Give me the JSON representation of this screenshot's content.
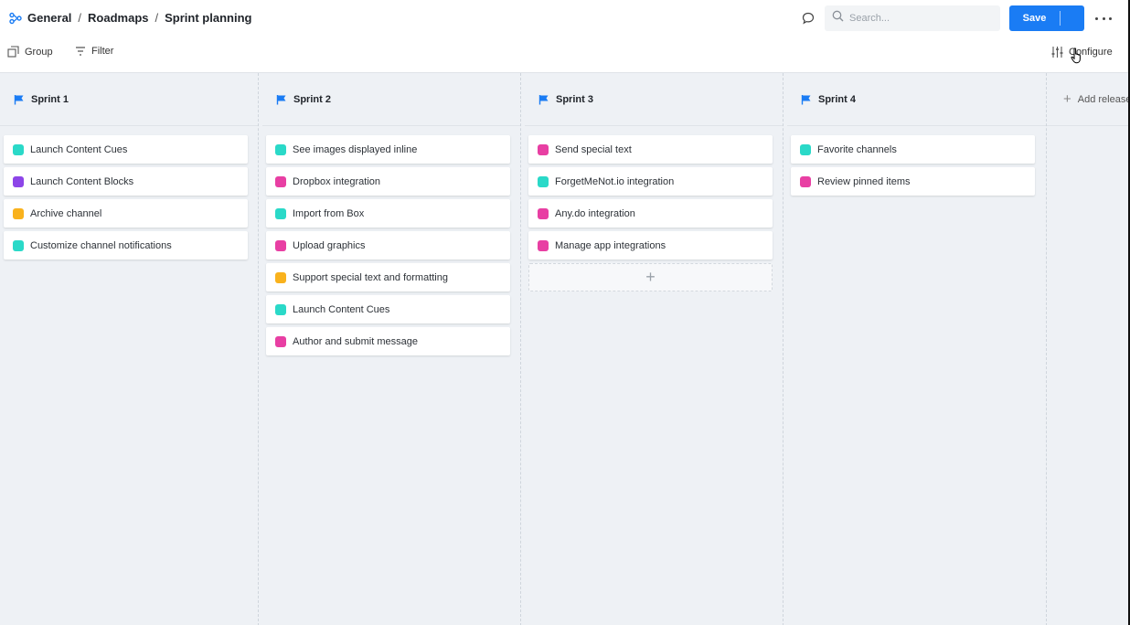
{
  "header": {
    "breadcrumbs": [
      "General",
      "Roadmaps",
      "Sprint planning"
    ],
    "separator": "/",
    "search_placeholder": "Search...",
    "save_label": "Save"
  },
  "toolbar": {
    "group_label": "Group",
    "filter_label": "Filter",
    "configure_label": "Configure"
  },
  "colors": {
    "teal": "#2ad9c8",
    "purple": "#8d45e8",
    "orange": "#f9b21d",
    "pink": "#e83fa3",
    "accent": "#1a7cf4"
  },
  "columns": [
    {
      "title": "Sprint 1",
      "cards": [
        {
          "label": "Launch Content Cues",
          "color": "#2ad9c8"
        },
        {
          "label": "Launch Content Blocks",
          "color": "#8d45e8"
        },
        {
          "label": "Archive channel",
          "color": "#f9b21d"
        },
        {
          "label": "Customize channel notifications",
          "color": "#2ad9c8"
        }
      ]
    },
    {
      "title": "Sprint 2",
      "cards": [
        {
          "label": "See images displayed inline",
          "color": "#2ad9c8"
        },
        {
          "label": "Dropbox integration",
          "color": "#e83fa3"
        },
        {
          "label": "Import from Box",
          "color": "#2ad9c8"
        },
        {
          "label": "Upload graphics",
          "color": "#e83fa3"
        },
        {
          "label": "Support special text and formatting",
          "color": "#f9b21d"
        },
        {
          "label": "Launch Content Cues",
          "color": "#2ad9c8"
        },
        {
          "label": "Author and submit message",
          "color": "#e83fa3"
        }
      ]
    },
    {
      "title": "Sprint 3",
      "cards": [
        {
          "label": "Send special text",
          "color": "#e83fa3"
        },
        {
          "label": "ForgetMeNot.io integration",
          "color": "#2ad9c8"
        },
        {
          "label": "Any.do integration",
          "color": "#e83fa3"
        },
        {
          "label": "Manage app integrations",
          "color": "#e83fa3"
        }
      ],
      "add_card": "+"
    },
    {
      "title": "Sprint 4",
      "cards": [
        {
          "label": "Favorite channels",
          "color": "#2ad9c8"
        },
        {
          "label": "Review pinned items",
          "color": "#e83fa3"
        }
      ]
    }
  ],
  "add_release_label": "Add release"
}
